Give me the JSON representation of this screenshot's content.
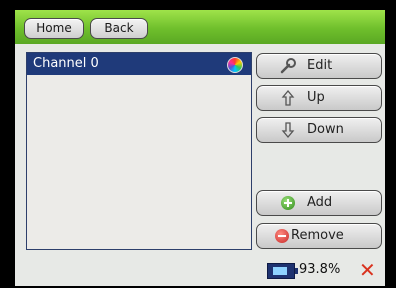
{
  "nav": {
    "home_label": "Home",
    "back_label": "Back"
  },
  "channels": [
    {
      "label": "Channel 0",
      "selected": true
    }
  ],
  "actions": {
    "edit_label": "Edit",
    "up_label": "Up",
    "down_label": "Down",
    "add_label": "Add",
    "remove_label": "Remove"
  },
  "status": {
    "battery_percent": "93.8%",
    "battery_level": 0.938
  },
  "colors": {
    "topbar": "#7cc832",
    "selection": "#1f3a7a",
    "close": "#d9321e"
  },
  "icons": {
    "edit": "wrench-icon",
    "up": "arrow-up-icon",
    "down": "arrow-down-icon",
    "add": "plus-circle-icon",
    "remove": "minus-circle-icon",
    "battery": "battery-icon",
    "close": "close-icon"
  }
}
